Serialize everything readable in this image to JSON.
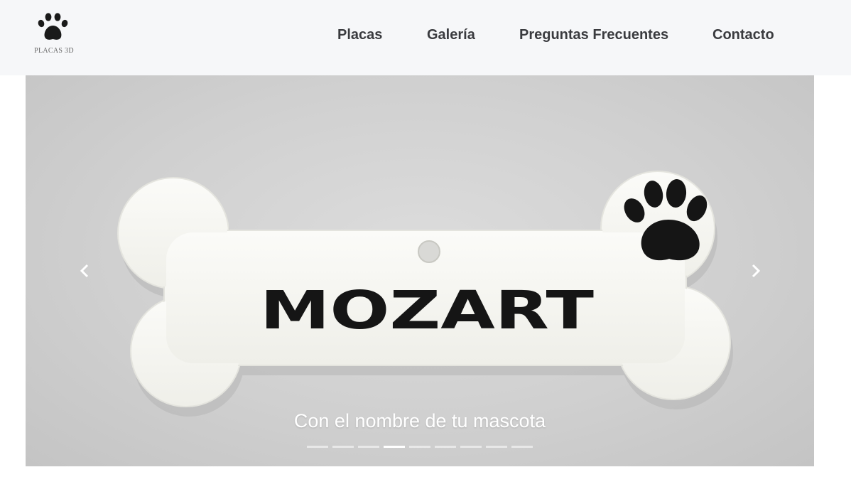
{
  "brand": {
    "logo_icon": "paw-icon",
    "text": "PLACAS 3D"
  },
  "nav": {
    "items": [
      {
        "label": "Placas"
      },
      {
        "label": "Galería"
      },
      {
        "label": "Preguntas Frecuentes"
      },
      {
        "label": "Contacto"
      }
    ]
  },
  "carousel": {
    "slide_image": "bone-shaped-pet-tag-photo",
    "tag_text": "MOZART",
    "caption": "Con el nombre de tu mascota",
    "prev_icon": "chevron-left-icon",
    "next_icon": "chevron-right-icon",
    "indicator_count": 9,
    "active_index": 3
  },
  "colors": {
    "navbar_bg": "#f6f7f9",
    "nav_text": "#3a3b3f",
    "caption_text": "#ffffff"
  }
}
